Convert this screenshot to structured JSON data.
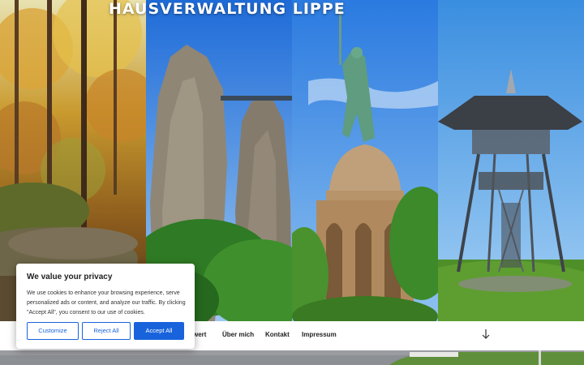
{
  "site": {
    "title": "HAUSVERWALTUNG LIPPE"
  },
  "nav": {
    "items": [
      {
        "label": "wert"
      },
      {
        "label": "Über mich"
      },
      {
        "label": "Kontakt"
      },
      {
        "label": "Impressum"
      }
    ],
    "scroll_icon": "arrow-down-icon"
  },
  "cookie_banner": {
    "title": "We value your privacy",
    "text": "We use cookies to enhance your browsing experience, serve personalized ads or content, and analyze our traffic. By clicking \"Accept All\", you consent to our use of cookies.",
    "customize_label": "Customize",
    "reject_label": "Reject All",
    "accept_label": "Accept All",
    "accent_color": "#1863dc"
  }
}
